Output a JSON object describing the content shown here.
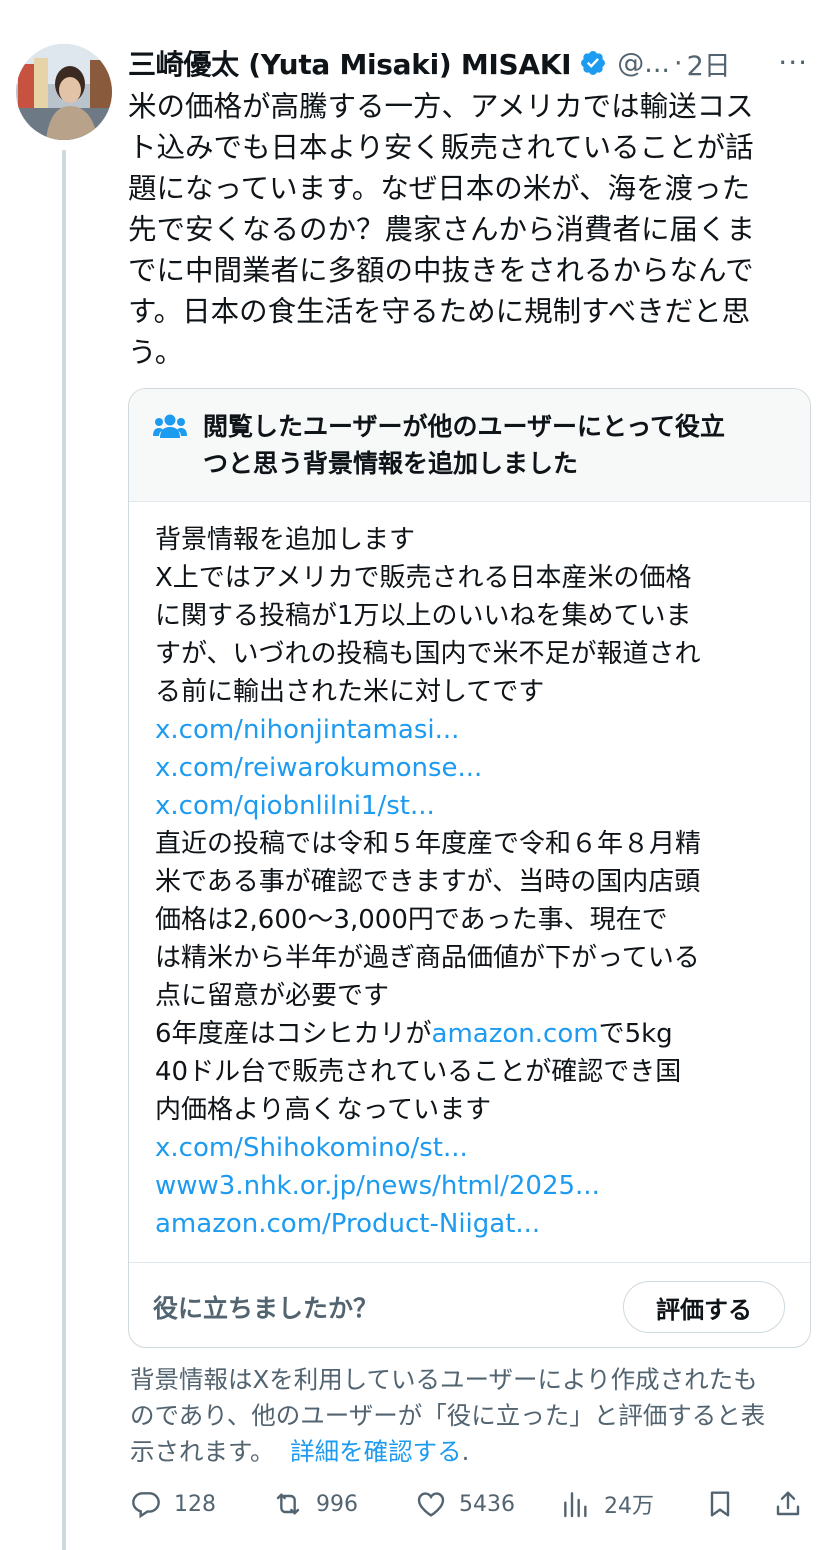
{
  "tweet": {
    "author_name": "三崎優太 (Yuta Misaki) MISAKI",
    "handle": "@...",
    "separator": "·",
    "time": "2日",
    "more": "···",
    "text_lines": [
      "米の価格が高騰する一方、アメリカでは輸送コス",
      "ト込みでも日本より安く販売されていることが話",
      "題になっています。なぜ日本の米が、海を渡った",
      "先で安くなるのか？農家さんから消費者に届くま",
      "でに中間業者に多額の中抜きをされるからなんで",
      "す。日本の食生活を守るために規制すべきだと思",
      "う。"
    ]
  },
  "community_note": {
    "title_line1": "閲覧したユーザーが他のユーザーにとって役立",
    "title_line2": "つと思う背景情報を追加しました",
    "body": [
      "背景情報を追加します",
      "X上ではアメリカで販売される日本産米の価格",
      "に関する投稿が1万以上のいいねを集めていま",
      "すが、いづれの投稿も国内で米不足が報道され",
      "る前に輸出された米に対してです",
      "x.com/nihonjintamasi...",
      "x.com/reiwarokumonse...",
      "x.com/qiobnlilni1/st...",
      "直近の投稿では令和５年度産で令和６年８月精",
      "米である事が確認できますが、当時の国内店頭",
      "価格は2,600〜3,000円であった事、現在で",
      "は精米から半年が過ぎ商品価値が下がっている",
      "点に留意が必要です",
      "6年度産はコシヒカリが",
      "amazon.com",
      "で5kg",
      "40ドル台で販売されていることが確認でき国",
      "内価格より高くなっています",
      "x.com/Shihokomino/st...",
      "www3.nhk.or.jp/news/html/2025...",
      "amazon.com/Product-Niigat..."
    ],
    "helpful_question": "役に立ちましたか？",
    "rate_button": "評価する"
  },
  "disclaimer": {
    "line1": "背景情報はXを利用しているユーザーにより作成されたも",
    "line2": "のであり、他のユーザーが「役に立った」と評価すると表",
    "line3_prefix": "示されます。",
    "line3_link": "詳細を確認する",
    "line3_suffix": "."
  },
  "actions": {
    "replies": "128",
    "reposts": "996",
    "likes": "5436",
    "views": "24万"
  },
  "colors": {
    "link": "#1d9bf0",
    "verified": "#1d9bf0",
    "secondary_text": "#536471",
    "border": "#cfd9de"
  },
  "icons": [
    "reply-icon",
    "repost-icon",
    "like-icon",
    "views-icon",
    "bookmark-icon",
    "share-icon",
    "verified-badge-icon",
    "community-note-icon"
  ]
}
